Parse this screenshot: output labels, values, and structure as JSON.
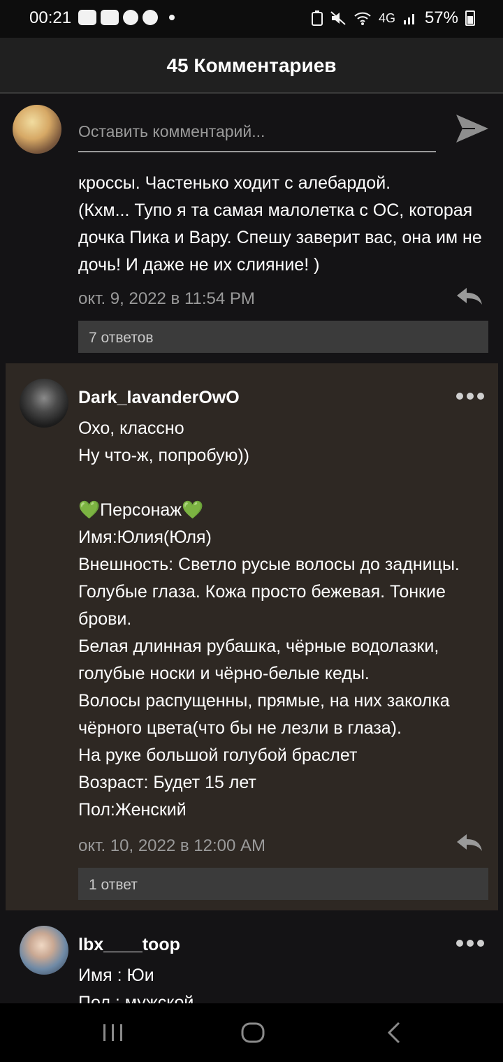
{
  "status_bar": {
    "time": "00:21",
    "left_icons": [
      "youtube-icon",
      "youtube-icon",
      "pinterest-icon",
      "app-icon"
    ],
    "network": "4G",
    "battery": "57%"
  },
  "header": {
    "title": "45 Комментариев"
  },
  "compose": {
    "placeholder": "Оставить комментарий..."
  },
  "comments": [
    {
      "text": "кроссы. Частенько ходит с алебардой.\n(Кхм... Тупо я та самая малолетка с ОС, которая дочка Пика и Вару. Спешу заверит вас, она им не дочь! И даже не их слияние! )",
      "timestamp": "окт. 9, 2022 в 11:54 PM",
      "replies": "7 ответов"
    },
    {
      "username": "Dark_lavanderOwO",
      "text": "Охо, классно\nНу что-ж, попробую))\n\n💚Персонаж💚\nИмя:Юлия(Юля)\nВнешность: Светло русые волосы до задницы. Голубые глаза. Кожа просто бежевая. Тонкие брови.\nБелая длинная рубашка, чёрные водолазки, голубые носки и чёрно-белые кеды.\nВолосы распущенны, прямые, на них заколка чёрного цвета(что бы не лезли в глаза).\nНа руке большой голубой браслет\nВозраст: Будет 15 лет\nПол:Женский",
      "timestamp": "окт. 10, 2022 в 12:00 AM",
      "replies": "1 ответ"
    },
    {
      "username": "lbx____toop",
      "text": "Имя : Юи\nПол : мужской"
    }
  ],
  "colors": {
    "background": "#141315",
    "highlight": "#2e2823",
    "header": "#202020",
    "muted_text": "#9a9a9a",
    "replies_bg": "#3b3b3b"
  }
}
